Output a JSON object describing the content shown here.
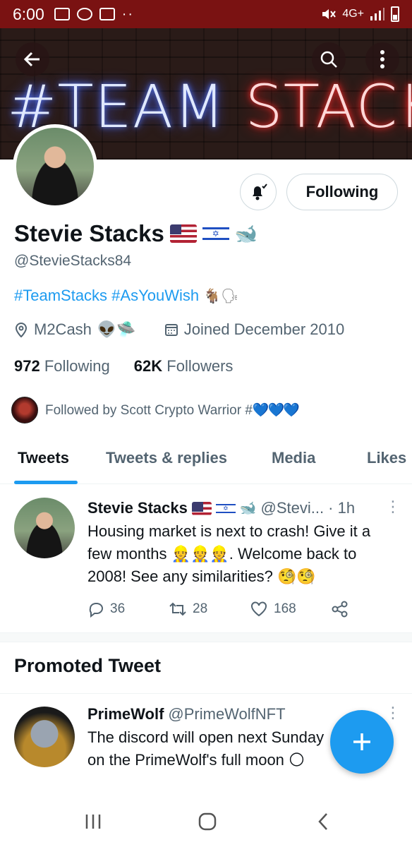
{
  "status_bar": {
    "time": "6:00",
    "network": "4G+",
    "dots": "··"
  },
  "banner": {
    "text_blue": "#TEAM",
    "text_red": "STACKS"
  },
  "profile": {
    "name": "Stevie Stacks",
    "handle": "@StevieStacks84",
    "bio_tags": "#TeamStacks #AsYouWish",
    "bio_emoji": "🐐🗣",
    "location": "M2Cash",
    "location_emoji": "👽🛸",
    "joined": "Joined December 2010",
    "following_count": "972",
    "following_label": "Following",
    "followers_count": "62K",
    "followers_label": "Followers",
    "followed_by": "Followed by Scott Crypto Warrior #",
    "followed_by_hearts": "💙💙💙",
    "follow_button": "Following"
  },
  "tabs": [
    "Tweets",
    "Tweets & replies",
    "Media",
    "Likes"
  ],
  "tweet1": {
    "name": "Stevie Stacks",
    "handle": "@Stevi...",
    "time": "· 1h",
    "text_part1": "Housing market is next to crash! Give it a few months ",
    "people_emoji": "👷👷👷",
    "text_part2": ". Welcome back to 2008! See any similarities? ",
    "monocle_emoji": "🧐🧐",
    "replies": "36",
    "retweets": "28",
    "likes": "168"
  },
  "promoted_header": "Promoted Tweet",
  "tweet2": {
    "name": "PrimeWolf",
    "handle": "@PrimeWolfNFT",
    "text": "The discord will open next Sunday on the PrimeWolf's full moon",
    "moon_emoji": "🌕"
  },
  "colors": {
    "accent": "#1d9bf0",
    "status_bar": "#7a1212",
    "text": "#0f1419",
    "muted": "#536471"
  }
}
